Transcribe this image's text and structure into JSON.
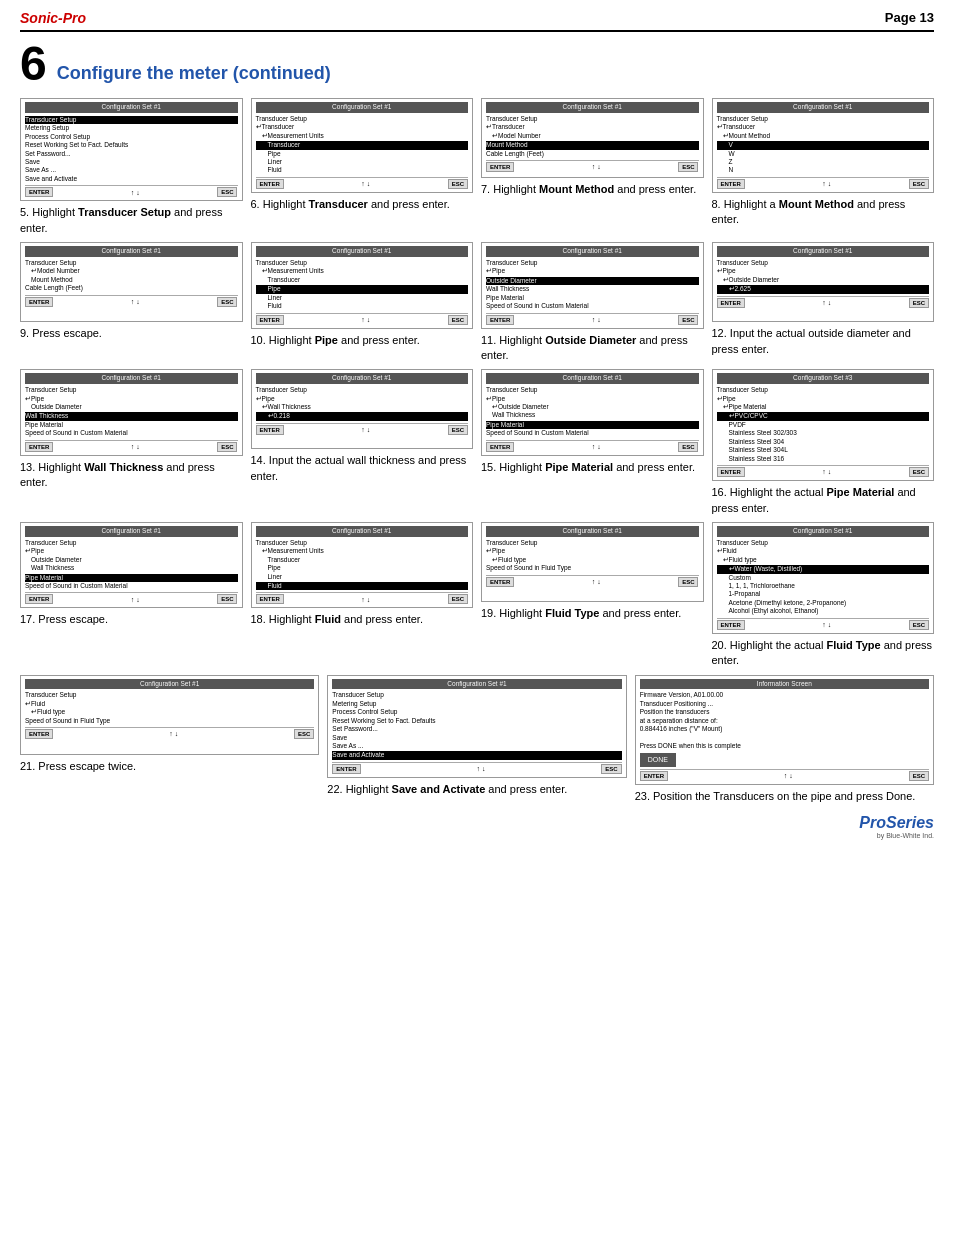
{
  "header": {
    "brand": "Sonic-Pro",
    "page": "Page 13"
  },
  "section": {
    "number": "6",
    "title": "Configure the meter (continued)"
  },
  "steps": [
    {
      "id": 5,
      "screen_title": "Configuration Set #1",
      "lines": [
        {
          "text": "Transducer Setup",
          "style": "highlighted"
        },
        {
          "text": "Metering Setup",
          "style": "normal"
        },
        {
          "text": "Process Control Setup",
          "style": "normal"
        },
        {
          "text": "Reset Working Set to Fact. Defaults",
          "style": "normal"
        },
        {
          "text": "Set Password...",
          "style": "normal"
        },
        {
          "text": "Save",
          "style": "normal"
        },
        {
          "text": "Save As ...",
          "style": "normal"
        },
        {
          "text": "Save and Activate",
          "style": "normal"
        }
      ],
      "description": "5. Highlight <b>Transducer Setup</b> and press enter."
    },
    {
      "id": 6,
      "screen_title": "Configuration Set #1",
      "lines": [
        {
          "text": "Transducer Setup",
          "style": "normal"
        },
        {
          "text": "↵Transducer",
          "style": "normal"
        },
        {
          "text": "↵Measurement Units",
          "style": "indent1"
        },
        {
          "text": "Transducer",
          "style": "highlighted indent2"
        },
        {
          "text": "Pipe",
          "style": "normal indent2"
        },
        {
          "text": "Liner",
          "style": "normal indent2"
        },
        {
          "text": "Fluid",
          "style": "normal indent2"
        }
      ],
      "description": "6. Highlight <b>Transducer</b> and press enter."
    },
    {
      "id": 7,
      "screen_title": "Configuration Set #1",
      "lines": [
        {
          "text": "Transducer Setup",
          "style": "normal"
        },
        {
          "text": "↵Transducer",
          "style": "normal"
        },
        {
          "text": "↵Model Number",
          "style": "indent1"
        },
        {
          "text": "Mount Method",
          "style": "highlighted"
        },
        {
          "text": "Cable Length (Feet)",
          "style": "normal"
        }
      ],
      "description": "7. Highlight <b>Mount Method</b> and press enter."
    },
    {
      "id": 8,
      "screen_title": "Configuration Set #1",
      "lines": [
        {
          "text": "Transducer Setup",
          "style": "normal"
        },
        {
          "text": "↵Transducer",
          "style": "normal"
        },
        {
          "text": "↵Mount Method",
          "style": "indent1"
        },
        {
          "text": "V",
          "style": "highlighted indent2"
        },
        {
          "text": "W",
          "style": "normal indent2"
        },
        {
          "text": "Z",
          "style": "normal indent2"
        },
        {
          "text": "N",
          "style": "normal indent2"
        }
      ],
      "description": "8. Highlight a <b>Mount Method</b> and press enter."
    },
    {
      "id": 9,
      "screen_title": "Configuration Set #1",
      "lines": [
        {
          "text": "Transducer Setup",
          "style": "normal"
        },
        {
          "text": "↵Model Number",
          "style": "indent1"
        },
        {
          "text": "Mount Method",
          "style": "normal indent1"
        },
        {
          "text": "Cable Length (Feet)",
          "style": "normal"
        }
      ],
      "description": "9. Press escape."
    },
    {
      "id": 10,
      "screen_title": "Configuration Set #1",
      "lines": [
        {
          "text": "Transducer Setup",
          "style": "normal"
        },
        {
          "text": "↵Measurement Units",
          "style": "indent1"
        },
        {
          "text": "Transducer",
          "style": "normal indent2"
        },
        {
          "text": "Pipe",
          "style": "highlighted indent2"
        },
        {
          "text": "Liner",
          "style": "normal indent2"
        },
        {
          "text": "Fluid",
          "style": "normal indent2"
        }
      ],
      "description": "10. Highlight <b>Pipe</b> and press enter."
    },
    {
      "id": 11,
      "screen_title": "Configuration Set #1",
      "lines": [
        {
          "text": "Transducer Setup",
          "style": "normal"
        },
        {
          "text": "↵Pipe",
          "style": "normal"
        },
        {
          "text": "Outside Diameter",
          "style": "highlighted"
        },
        {
          "text": "Wall Thickness",
          "style": "normal"
        },
        {
          "text": "Pipe Material",
          "style": "normal"
        },
        {
          "text": "Speed of Sound in Custom Material",
          "style": "normal"
        }
      ],
      "description": "11. Highlight <b>Outside Diameter</b> and press enter."
    },
    {
      "id": 12,
      "screen_title": "Configuration Set #1",
      "lines": [
        {
          "text": "Transducer Setup",
          "style": "normal"
        },
        {
          "text": "↵Pipe",
          "style": "normal"
        },
        {
          "text": "↵Outside Diameter",
          "style": "indent1"
        },
        {
          "text": "↵2.625",
          "style": "highlighted indent2"
        }
      ],
      "description": "12. Input the actual outside diameter and press enter."
    },
    {
      "id": 13,
      "screen_title": "Configuration Set #1",
      "lines": [
        {
          "text": "Transducer Setup",
          "style": "normal"
        },
        {
          "text": "↵Pipe",
          "style": "normal"
        },
        {
          "text": "Outside Diameter",
          "style": "normal indent1"
        },
        {
          "text": "Wall Thickness",
          "style": "highlighted"
        },
        {
          "text": "Pipe Material",
          "style": "normal"
        },
        {
          "text": "Speed of Sound in Custom Material",
          "style": "normal"
        }
      ],
      "description": "13. Highlight <b>Wall Thickness</b> and press enter."
    },
    {
      "id": 14,
      "screen_title": "Configuration Set #1",
      "lines": [
        {
          "text": "Transducer Setup",
          "style": "normal"
        },
        {
          "text": "↵Pipe",
          "style": "normal"
        },
        {
          "text": "↵Wall Thickness",
          "style": "indent1"
        },
        {
          "text": "↵0.218",
          "style": "highlighted indent2"
        }
      ],
      "description": "14. Input the actual wall thickness and press enter."
    },
    {
      "id": 15,
      "screen_title": "Configuration Set #1",
      "lines": [
        {
          "text": "Transducer Setup",
          "style": "normal"
        },
        {
          "text": "↵Pipe",
          "style": "normal"
        },
        {
          "text": "↵Outside Diameter",
          "style": "indent1"
        },
        {
          "text": "Wall Thickness",
          "style": "normal indent1"
        },
        {
          "text": "Pipe Material",
          "style": "highlighted"
        },
        {
          "text": "Speed of Sound in Custom Material",
          "style": "normal"
        }
      ],
      "description": "15. Highlight <b>Pipe Material</b> and press enter."
    },
    {
      "id": 16,
      "screen_title": "Configuration Set #3",
      "lines": [
        {
          "text": "Transducer Setup",
          "style": "normal"
        },
        {
          "text": "↵Pipe",
          "style": "normal"
        },
        {
          "text": "↵Pipe Material",
          "style": "indent1"
        },
        {
          "text": "↵PVC/CPVC",
          "style": "highlighted indent2"
        },
        {
          "text": "PVDF",
          "style": "normal indent2"
        },
        {
          "text": "Stainless Steel 302/303",
          "style": "normal indent2"
        },
        {
          "text": "Stainless Steel 304",
          "style": "normal indent2"
        },
        {
          "text": "Stainless Steel 304L",
          "style": "normal indent2"
        },
        {
          "text": "Stainless Steel 316",
          "style": "normal indent2"
        }
      ],
      "description": "16. Highlight the actual <b>Pipe Material</b> and press enter."
    },
    {
      "id": 17,
      "screen_title": "Configuration Set #1",
      "lines": [
        {
          "text": "Transducer Setup",
          "style": "normal"
        },
        {
          "text": "↵Pipe",
          "style": "normal"
        },
        {
          "text": "Outside Diameter",
          "style": "normal indent1"
        },
        {
          "text": "Wall Thickness",
          "style": "normal indent1"
        },
        {
          "text": "Pipe Material",
          "style": "highlighted"
        },
        {
          "text": "Speed of Sound in Custom Material",
          "style": "normal"
        }
      ],
      "description": "17. Press escape."
    },
    {
      "id": 18,
      "screen_title": "Configuration Set #1",
      "lines": [
        {
          "text": "Transducer Setup",
          "style": "normal"
        },
        {
          "text": "↵Measurement Units",
          "style": "indent1"
        },
        {
          "text": "Transducer",
          "style": "normal indent2"
        },
        {
          "text": "Pipe",
          "style": "normal indent2"
        },
        {
          "text": "Liner",
          "style": "normal indent2"
        },
        {
          "text": "Fluid",
          "style": "highlighted indent2"
        }
      ],
      "description": "18. Highlight <b>Fluid</b> and press enter."
    },
    {
      "id": 19,
      "screen_title": "Configuration Set #1",
      "lines": [
        {
          "text": "Transducer Setup",
          "style": "normal"
        },
        {
          "text": "↵Pipe",
          "style": "normal"
        },
        {
          "text": "↵Fluid type",
          "style": "indent1"
        },
        {
          "text": "Speed of Sound in Fluid Type",
          "style": "normal"
        }
      ],
      "description": "19. Highlight <b>Fluid Type</b> and press enter."
    },
    {
      "id": 20,
      "screen_title": "Configuration Set #1",
      "lines": [
        {
          "text": "Transducer Setup",
          "style": "normal"
        },
        {
          "text": "↵Fluid",
          "style": "normal"
        },
        {
          "text": "↵Fluid type",
          "style": "indent1"
        },
        {
          "text": "↵Water (Waste, Distilled)",
          "style": "highlighted indent2"
        },
        {
          "text": "Custom",
          "style": "normal indent2"
        },
        {
          "text": "1, 1, 1, Trichloroethane",
          "style": "normal indent2"
        },
        {
          "text": "1-Propanal",
          "style": "normal indent2"
        },
        {
          "text": "Acetone (Dimethyl ketone, 2-Propanone)",
          "style": "normal indent2"
        },
        {
          "text": "Alcohol (Ethyl alcohol, Ethanol)",
          "style": "normal indent2"
        }
      ],
      "description": "20. Highlight the actual <b>Fluid Type</b> and press enter."
    },
    {
      "id": 21,
      "screen_title": "Configuration Set #1",
      "lines": [
        {
          "text": "Transducer Setup",
          "style": "normal"
        },
        {
          "text": "↵Fluid",
          "style": "normal"
        },
        {
          "text": "↵Fluid type",
          "style": "indent1"
        },
        {
          "text": "Speed of Sound in Fluid Type",
          "style": "normal"
        }
      ],
      "description": "21. Press escape twice."
    },
    {
      "id": 22,
      "screen_title": "Configuration Set #1",
      "lines": [
        {
          "text": "Transducer Setup",
          "style": "normal"
        },
        {
          "text": "Metering Setup",
          "style": "normal"
        },
        {
          "text": "Process Control Setup",
          "style": "normal"
        },
        {
          "text": "Reset Working Set to Fact. Defaults",
          "style": "normal"
        },
        {
          "text": "Set Password...",
          "style": "normal"
        },
        {
          "text": "Save",
          "style": "normal"
        },
        {
          "text": "Save As ...",
          "style": "normal"
        },
        {
          "text": "Save and Activate",
          "style": "highlighted"
        }
      ],
      "description": "22. Highlight <b>Save and Activate</b> and press enter."
    },
    {
      "id": 23,
      "screen_title": "Information Screen",
      "info_lines": [
        "Firmware Version, A01.00.00",
        "Transducer Positioning ...",
        "Position the transducers",
        "at a separation distance of:",
        "0.884416 inches (\"V\" Mount)",
        "",
        "Press DONE when this is complete"
      ],
      "has_done_btn": true,
      "description": "23. Position the Transducers on the pipe and press Done."
    }
  ],
  "logo": {
    "main": "ProSeries",
    "sub": "by Blue-White Ind."
  }
}
